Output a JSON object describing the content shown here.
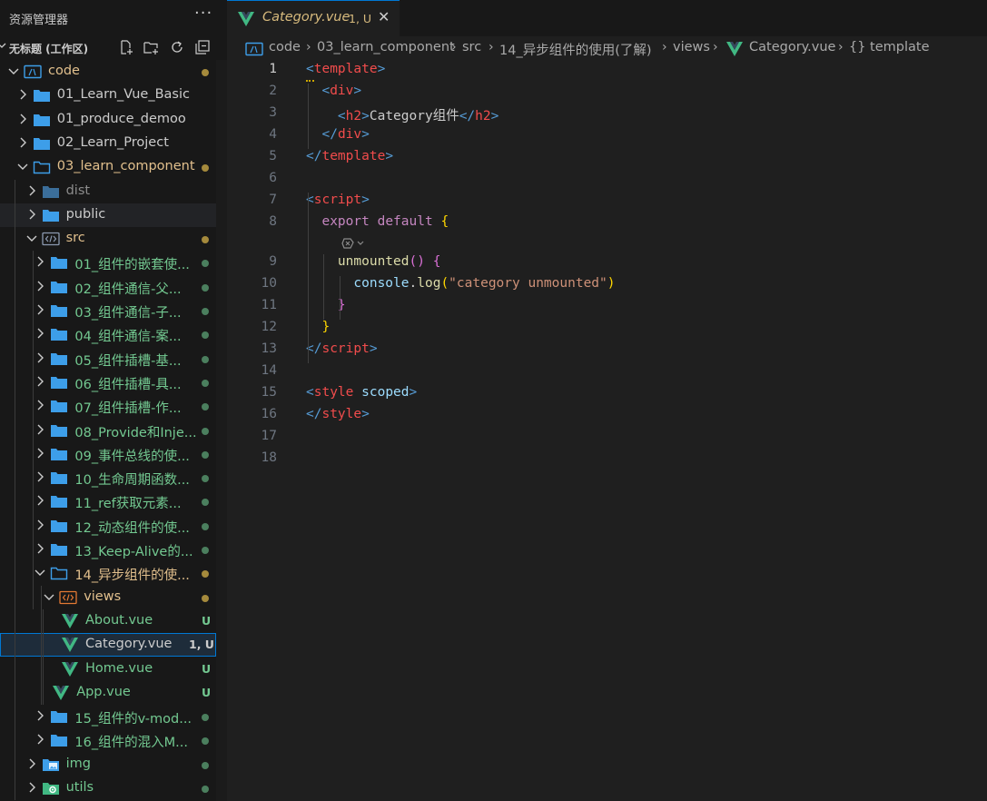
{
  "explorer": {
    "title": "资源管理器",
    "more": "···",
    "workspace": "无标题 (工作区)",
    "tree": [
      {
        "label": "code",
        "depth": 0,
        "type": "root",
        "open": true,
        "color": "#e2c08d",
        "status": "dot",
        "dotColor": "#a58a3c"
      },
      {
        "label": "01_Learn_Vue_Basic",
        "depth": 1,
        "type": "folder",
        "open": false,
        "color": "#cccccc",
        "status": "none"
      },
      {
        "label": "01_produce_demoo",
        "depth": 1,
        "type": "folder",
        "open": false,
        "color": "#cccccc",
        "status": "none"
      },
      {
        "label": "02_Learn_Project",
        "depth": 1,
        "type": "folder",
        "open": false,
        "color": "#cccccc",
        "status": "none"
      },
      {
        "label": "03_learn_component",
        "depth": 1,
        "type": "folder",
        "open": true,
        "color": "#e2c08d",
        "status": "dot",
        "dotColor": "#a58a3c"
      },
      {
        "label": "dist",
        "depth": 2,
        "type": "folder",
        "open": false,
        "color": "#8c8c8c",
        "status": "none",
        "icon": "folder-dim"
      },
      {
        "label": "public",
        "depth": 2,
        "type": "folder",
        "open": false,
        "color": "#cccccc",
        "status": "none"
      },
      {
        "label": "src",
        "depth": 2,
        "type": "src",
        "open": true,
        "color": "#e2c08d",
        "status": "dot",
        "dotColor": "#a58a3c"
      },
      {
        "label": "01_组件的嵌套使...",
        "depth": 3,
        "type": "folder",
        "open": false,
        "color": "#73c991",
        "status": "dot",
        "dotColor": "#4b7f5e"
      },
      {
        "label": "02_组件通信-父...",
        "depth": 3,
        "type": "folder",
        "open": false,
        "color": "#73c991",
        "status": "dot",
        "dotColor": "#4b7f5e"
      },
      {
        "label": "03_组件通信-子...",
        "depth": 3,
        "type": "folder",
        "open": false,
        "color": "#73c991",
        "status": "dot",
        "dotColor": "#4b7f5e"
      },
      {
        "label": "04_组件通信-案...",
        "depth": 3,
        "type": "folder",
        "open": false,
        "color": "#73c991",
        "status": "dot",
        "dotColor": "#4b7f5e"
      },
      {
        "label": "05_组件插槽-基...",
        "depth": 3,
        "type": "folder",
        "open": false,
        "color": "#73c991",
        "status": "dot",
        "dotColor": "#4b7f5e"
      },
      {
        "label": "06_组件插槽-具...",
        "depth": 3,
        "type": "folder",
        "open": false,
        "color": "#73c991",
        "status": "dot",
        "dotColor": "#4b7f5e"
      },
      {
        "label": "07_组件插槽-作...",
        "depth": 3,
        "type": "folder",
        "open": false,
        "color": "#73c991",
        "status": "dot",
        "dotColor": "#4b7f5e"
      },
      {
        "label": "08_Provide和Inje...",
        "depth": 3,
        "type": "folder",
        "open": false,
        "color": "#73c991",
        "status": "dot",
        "dotColor": "#4b7f5e"
      },
      {
        "label": "09_事件总线的使...",
        "depth": 3,
        "type": "folder",
        "open": false,
        "color": "#73c991",
        "status": "dot",
        "dotColor": "#4b7f5e"
      },
      {
        "label": "10_生命周期函数...",
        "depth": 3,
        "type": "folder",
        "open": false,
        "color": "#73c991",
        "status": "dot",
        "dotColor": "#4b7f5e"
      },
      {
        "label": "11_ref获取元素...",
        "depth": 3,
        "type": "folder",
        "open": false,
        "color": "#73c991",
        "status": "dot",
        "dotColor": "#4b7f5e"
      },
      {
        "label": "12_动态组件的使...",
        "depth": 3,
        "type": "folder",
        "open": false,
        "color": "#73c991",
        "status": "dot",
        "dotColor": "#4b7f5e"
      },
      {
        "label": "13_Keep-Alive的...",
        "depth": 3,
        "type": "folder",
        "open": false,
        "color": "#73c991",
        "status": "dot",
        "dotColor": "#4b7f5e"
      },
      {
        "label": "14_异步组件的使...",
        "depth": 3,
        "type": "folder",
        "open": true,
        "color": "#e2c08d",
        "status": "dot",
        "dotColor": "#a58a3c"
      },
      {
        "label": "views",
        "depth": 4,
        "type": "views",
        "open": true,
        "color": "#e2c08d",
        "status": "dot",
        "dotColor": "#a58a3c"
      },
      {
        "label": "About.vue",
        "depth": 5,
        "type": "vue",
        "color": "#73c991",
        "status": "badge",
        "badge": "U",
        "badgeColor": "#73c991"
      },
      {
        "label": "Category.vue",
        "depth": 5,
        "type": "vue",
        "color": "#cccccc",
        "status": "badge",
        "badge": "1, U",
        "badgeColor": "#cccccc",
        "selected": true
      },
      {
        "label": "Home.vue",
        "depth": 5,
        "type": "vue",
        "color": "#73c991",
        "status": "badge",
        "badge": "U",
        "badgeColor": "#73c991"
      },
      {
        "label": "App.vue",
        "depth": 4,
        "type": "vue",
        "color": "#73c991",
        "status": "badge",
        "badge": "U",
        "badgeColor": "#73c991"
      },
      {
        "label": "15_组件的v-mod...",
        "depth": 3,
        "type": "folder",
        "open": false,
        "color": "#73c991",
        "status": "dot",
        "dotColor": "#4b7f5e"
      },
      {
        "label": "16_组件的混入M...",
        "depth": 3,
        "type": "folder",
        "open": false,
        "color": "#73c991",
        "status": "dot",
        "dotColor": "#4b7f5e"
      },
      {
        "label": "img",
        "depth": 2,
        "type": "img",
        "open": false,
        "color": "#73c991",
        "status": "dot",
        "dotColor": "#4b7f5e"
      },
      {
        "label": "utils",
        "depth": 2,
        "type": "utils",
        "open": false,
        "color": "#73c991",
        "status": "dot",
        "dotColor": "#4b7f5e"
      }
    ]
  },
  "tab": {
    "name": "Category.vue",
    "badge": "1, U",
    "close": "✕"
  },
  "breadcrumb": [
    "code",
    "03_learn_component",
    "src",
    "14_异步组件的使用(了解)",
    "views",
    "Category.vue",
    "{} template"
  ],
  "editor": {
    "line_numbers": [
      "1",
      "2",
      "3",
      "4",
      "5",
      "6",
      "7",
      "8",
      "9",
      "10",
      "11",
      "12",
      "13",
      "14",
      "15",
      "16",
      "17",
      "18"
    ],
    "lines": [
      [
        [
          "tg",
          "<"
        ],
        [
          "tn",
          "template"
        ],
        [
          "tg",
          ">"
        ]
      ],
      [
        [
          "",
          "  "
        ],
        [
          "tg",
          "<"
        ],
        [
          "tn",
          "div"
        ],
        [
          "tg",
          ">"
        ]
      ],
      [
        [
          "",
          "    "
        ],
        [
          "tg",
          "<"
        ],
        [
          "tn",
          "h2"
        ],
        [
          "tg",
          ">"
        ],
        [
          "",
          "Category组件"
        ],
        [
          "tg",
          "</"
        ],
        [
          "tn",
          "h2"
        ],
        [
          "tg",
          ">"
        ]
      ],
      [
        [
          "",
          "  "
        ],
        [
          "tg",
          "</"
        ],
        [
          "tn",
          "div"
        ],
        [
          "tg",
          ">"
        ]
      ],
      [
        [
          "tg",
          "</"
        ],
        [
          "tn",
          "template"
        ],
        [
          "tg",
          ">"
        ]
      ],
      [],
      [
        [
          "tg",
          "<"
        ],
        [
          "tn",
          "script"
        ],
        [
          "tg",
          ">"
        ]
      ],
      [
        [
          "",
          "  "
        ],
        [
          "kw",
          "export"
        ],
        [
          "",
          " "
        ],
        [
          "kw",
          "default"
        ],
        [
          "",
          " "
        ],
        [
          "br1",
          "{"
        ]
      ],
      [
        [
          "",
          "    "
        ],
        [
          "fn",
          "unmounted"
        ],
        [
          "br2",
          "()"
        ],
        [
          "",
          " "
        ],
        [
          "br2",
          "{"
        ]
      ],
      [
        [
          "",
          "      "
        ],
        [
          "vr",
          "console"
        ],
        [
          "",
          "."
        ],
        [
          "fn",
          "log"
        ],
        [
          "br1",
          "("
        ],
        [
          "st",
          "\"category unmounted\""
        ],
        [
          "br1",
          ")"
        ]
      ],
      [
        [
          "",
          "    "
        ],
        [
          "br2",
          "}"
        ]
      ],
      [
        [
          "",
          "  "
        ],
        [
          "br1",
          "}"
        ]
      ],
      [
        [
          "tg",
          "</"
        ],
        [
          "tn",
          "script"
        ],
        [
          "tg",
          ">"
        ]
      ],
      [],
      [
        [
          "tg",
          "<"
        ],
        [
          "tn",
          "style"
        ],
        [
          "",
          " "
        ],
        [
          "vr",
          "scoped"
        ],
        [
          "tg",
          ">"
        ]
      ],
      [
        [
          "tg",
          "</"
        ],
        [
          "tn",
          "style"
        ],
        [
          "tg",
          ">"
        ]
      ],
      [],
      []
    ]
  },
  "colors": {
    "accent": "#0078d4",
    "vue": "#41b883",
    "folder": "#3d9ee9",
    "modified": "#e2c08d",
    "untracked": "#73c991"
  }
}
